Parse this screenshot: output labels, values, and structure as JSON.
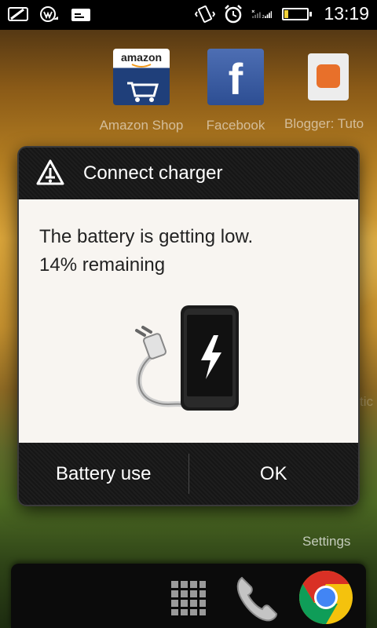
{
  "status_bar": {
    "icons_left": [
      "cast-icon",
      "wifi-notification-icon",
      "message-icon"
    ],
    "icons_right": [
      "vibrate-icon",
      "alarm-icon",
      "signal-strength-icon",
      "battery-icon"
    ],
    "network_label": "2",
    "battery_level_fraction": 0.14,
    "time": "13:19"
  },
  "home": {
    "shortcuts": [
      {
        "icon": "amazon-icon",
        "label": "Amazon Shop",
        "brand_text": "amazon"
      },
      {
        "icon": "facebook-icon",
        "label": "Facebook",
        "brand_text": "f"
      },
      {
        "icon": "blogger-icon",
        "label": "Blogger: Tuto"
      }
    ],
    "settings_label": "Settings",
    "partial_label": "tic"
  },
  "dialog": {
    "title": "Connect charger",
    "message_line1": "The battery is getting low.",
    "message_line2": "14% remaining",
    "illustration": "phone-charger-icon",
    "buttons": {
      "battery_use": "Battery use",
      "ok": "OK"
    }
  },
  "dock": {
    "items": [
      "app-drawer-icon",
      "phone-icon",
      "chrome-icon"
    ]
  },
  "colors": {
    "battery_fill": "#f2d23a",
    "dialog_body": "#f8f5f1",
    "chrome_red": "#d93025",
    "chrome_yellow": "#f4c20d",
    "chrome_green": "#0f9d58",
    "chrome_blue": "#4285f4"
  }
}
